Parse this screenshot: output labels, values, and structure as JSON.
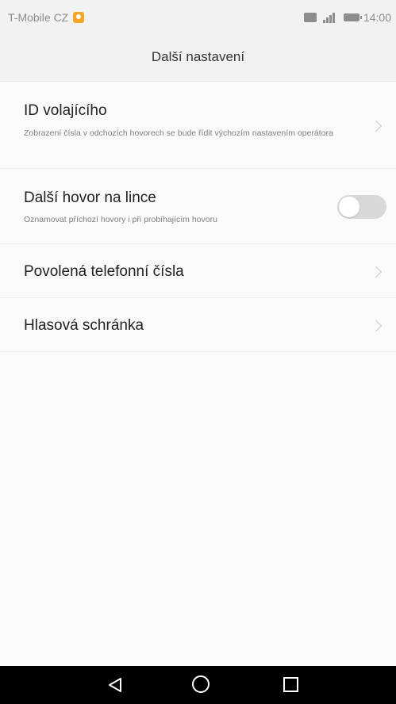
{
  "status_bar": {
    "carrier": "T-Mobile CZ",
    "time": "14:00",
    "icons": [
      "notification-icon",
      "hd-icon",
      "signal-icon",
      "battery-icon"
    ]
  },
  "header": {
    "title": "Další nastavení"
  },
  "settings": [
    {
      "title": "ID volajícího",
      "subtitle": "Zobrazení čísla v odchozích hovorech se bude řídit výchozím nastavením operátora",
      "control": "chevron"
    },
    {
      "title": "Další hovor na lince",
      "subtitle": "Oznamovat příchozí hovory i při probíhajícím hovoru",
      "control": "toggle",
      "toggle_on": false
    },
    {
      "title": "Povolená telefonní čísla",
      "control": "chevron"
    },
    {
      "title": "Hlasová schránka",
      "control": "chevron"
    }
  ],
  "nav_bar": {
    "icons": [
      "back-icon",
      "home-icon",
      "recent-apps-icon"
    ]
  },
  "colors": {
    "background": "#fafafa",
    "header_background": "#f2f2f2",
    "toggle_off": "#d8d8d8",
    "notification_accent": "#f5a623",
    "nav_bar": "#000000"
  }
}
